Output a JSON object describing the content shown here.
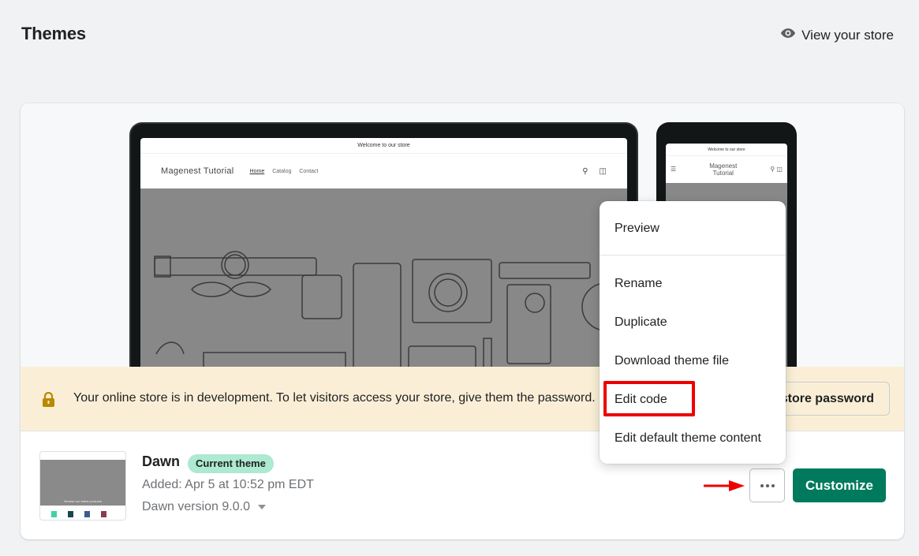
{
  "header": {
    "title": "Themes",
    "view_store_label": "View your store",
    "view_store_icon": "eye-icon"
  },
  "preview": {
    "desktop": {
      "announcement": "Welcome to our store",
      "store_name": "Magenest Tutorial",
      "nav": [
        "Home",
        "Catalog",
        "Contact"
      ],
      "icons": [
        "search-icon",
        "cart-icon"
      ]
    },
    "mobile": {
      "announcement": "Welcome to our store",
      "store_name_line1": "Magenest",
      "store_name_line2": "Tutorial",
      "icons": [
        "menu-icon",
        "search-icon",
        "cart-icon"
      ]
    }
  },
  "banner": {
    "icon": "lock-icon",
    "text": "Your online store is in development. To let visitors access your store, give them the password.",
    "button_label": "store password"
  },
  "theme": {
    "name": "Dawn",
    "badge": "Current theme",
    "added": "Added: Apr 5 at 10:52 pm EDT",
    "version": "Dawn version 9.0.0",
    "thumbnail_text": "Browse our latest products",
    "more_actions_icon": "ellipsis-icon",
    "customize_label": "Customize"
  },
  "menu": {
    "items": [
      {
        "label": "Preview"
      },
      {
        "label": "Rename"
      },
      {
        "label": "Duplicate"
      },
      {
        "label": "Download theme file"
      },
      {
        "label": "Edit code",
        "highlighted": true
      },
      {
        "label": "Edit default theme content"
      }
    ]
  },
  "colors": {
    "primary": "#007a5c",
    "badge_bg": "#aee9d1",
    "banner_bg": "#faefd6",
    "annotation_red": "#ee0000",
    "page_bg": "#f1f2f4"
  }
}
